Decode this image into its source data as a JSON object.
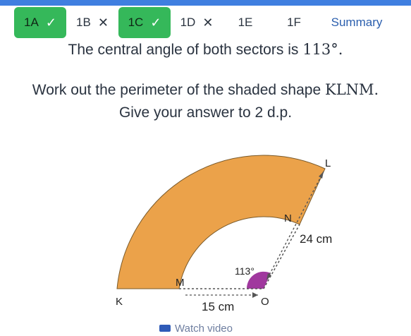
{
  "tabs": [
    {
      "label": "1A",
      "status": "correct"
    },
    {
      "label": "1B",
      "status": "incorrect"
    },
    {
      "label": "1C",
      "status": "correct"
    },
    {
      "label": "1D",
      "status": "incorrect"
    },
    {
      "label": "1E",
      "status": "none"
    },
    {
      "label": "1F",
      "status": "none"
    },
    {
      "label": "Summary",
      "status": "none"
    }
  ],
  "marks": {
    "correct": "✓",
    "incorrect": "✕"
  },
  "question": {
    "line1_text": "The central angle of both sectors is",
    "line1_math": "113°.",
    "line2_text": "Work out the perimeter of the shaded shape",
    "line2_math": "KLNM.",
    "line3_text": "Give your answer to 2 d.p."
  },
  "diagram": {
    "label_L": "L",
    "label_N": "N",
    "label_M": "M",
    "label_K": "K",
    "label_O": "O",
    "length_24": "24 cm",
    "length_15": "15 cm",
    "angle": "113°",
    "fill_color": "#eba24a",
    "sector_color": "#a0389e"
  },
  "footer": {
    "watch_label": "Watch video"
  },
  "colors": {
    "accent": "#3f7fe0",
    "done": "#35b85a"
  }
}
